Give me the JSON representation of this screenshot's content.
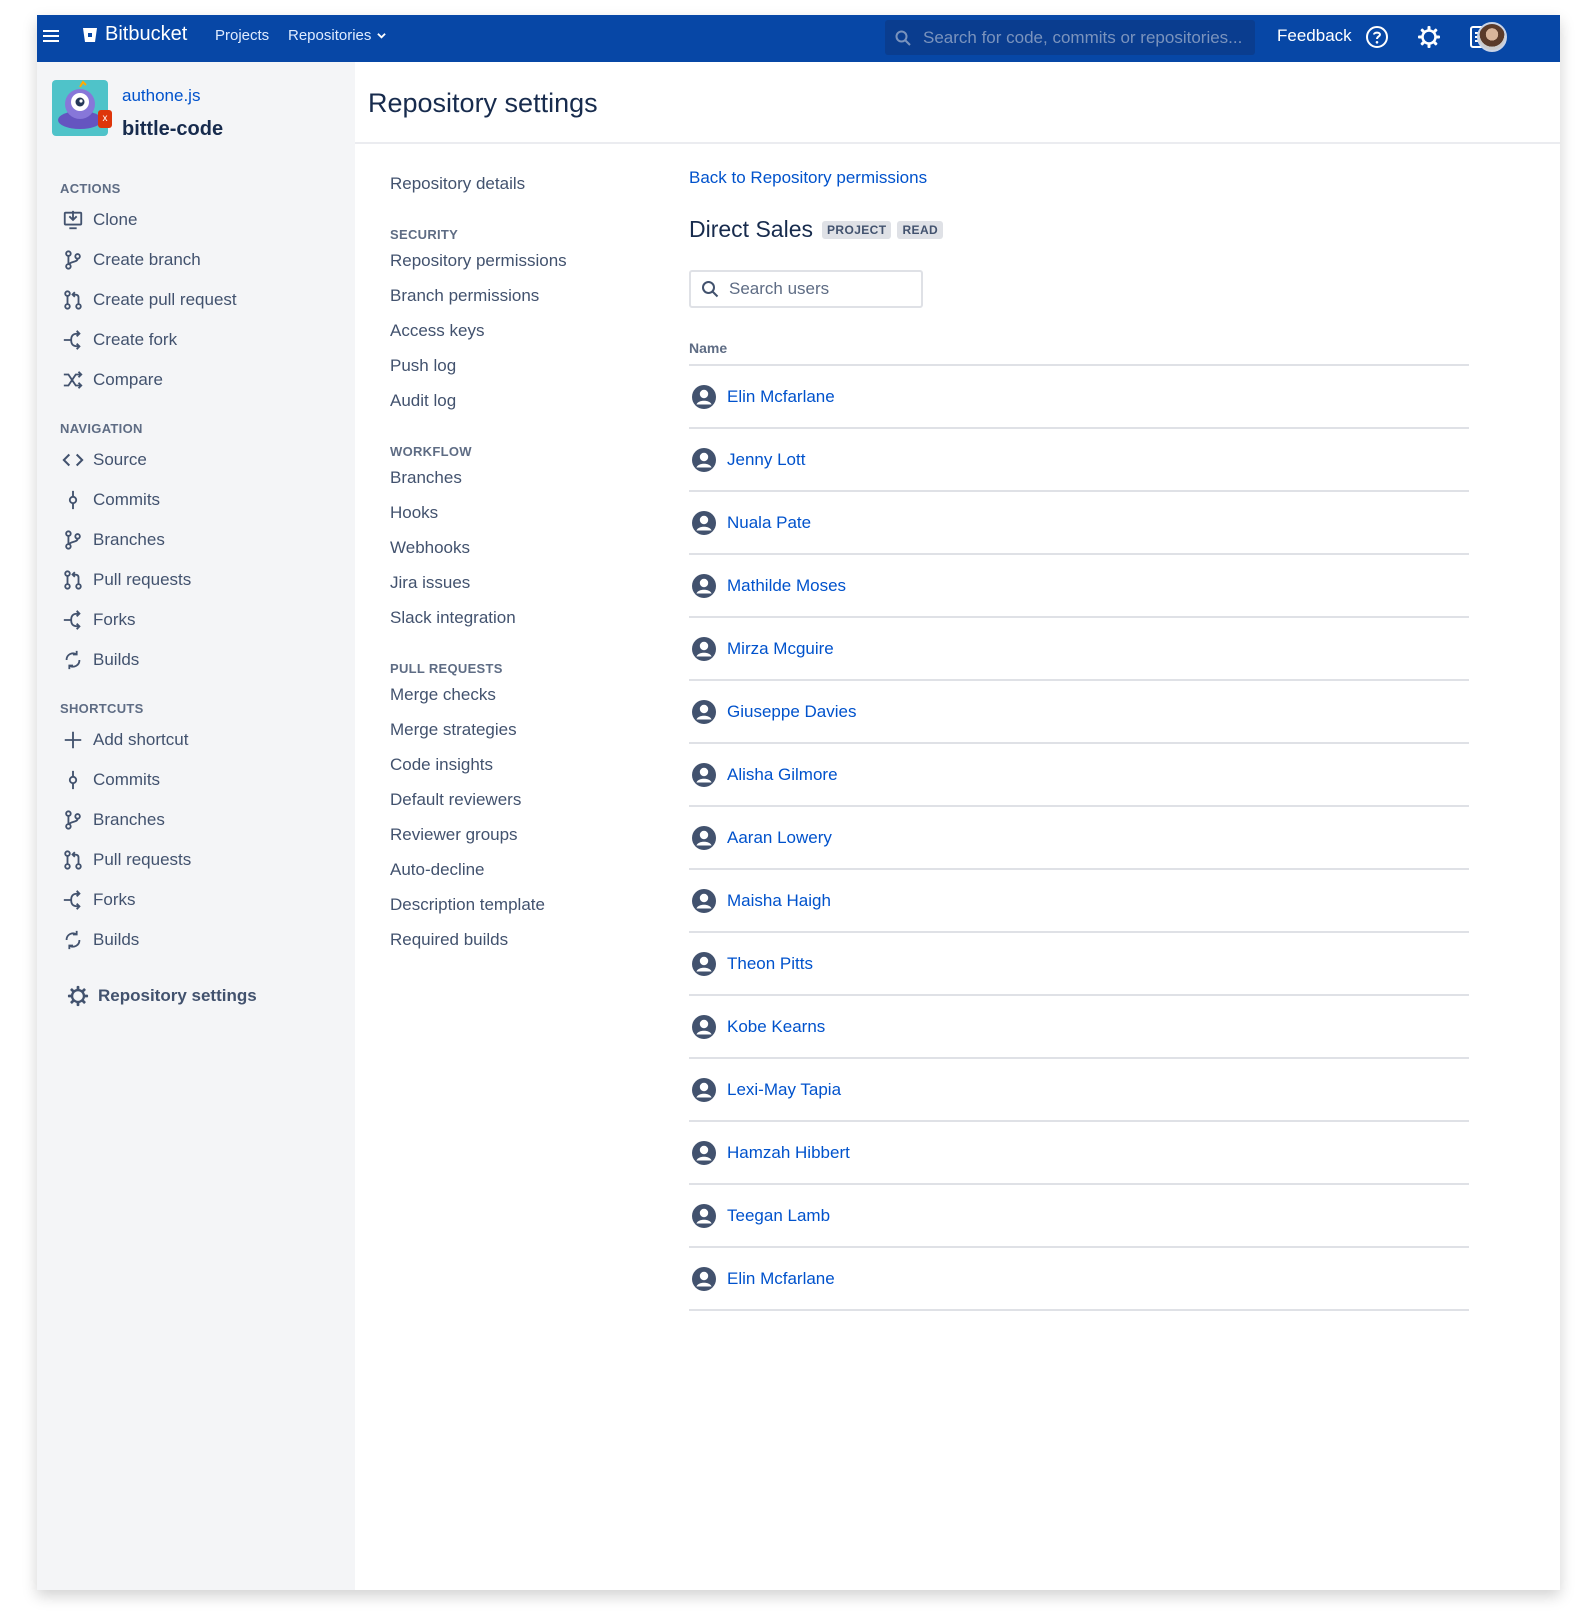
{
  "topbar": {
    "brand": "Bitbucket",
    "nav_projects": "Projects",
    "nav_repositories": "Repositories",
    "search_placeholder": "Search for code, commits or repositories...",
    "feedback": "Feedback"
  },
  "sidebar": {
    "project_name": "authone.js",
    "repo_name": "bittle-code",
    "repo_badge": "x",
    "sections": {
      "actions": "ACTIONS",
      "navigation": "NAVIGATION",
      "shortcuts": "SHORTCUTS"
    },
    "actions": [
      "Clone",
      "Create branch",
      "Create pull request",
      "Create fork",
      "Compare"
    ],
    "navigation": [
      "Source",
      "Commits",
      "Branches",
      "Pull requests",
      "Forks",
      "Builds"
    ],
    "shortcuts": [
      "Add shortcut",
      "Commits",
      "Branches",
      "Pull requests",
      "Forks",
      "Builds"
    ],
    "settings": "Repository settings"
  },
  "page": {
    "title": "Repository settings"
  },
  "subnav": {
    "repository_details": "Repository details",
    "security": {
      "heading": "SECURITY",
      "items": [
        "Repository permissions",
        "Branch permissions",
        "Access keys",
        "Push log",
        "Audit log"
      ]
    },
    "workflow": {
      "heading": "WORKFLOW",
      "items": [
        "Branches",
        "Hooks",
        "Webhooks",
        "Jira issues",
        "Slack integration"
      ]
    },
    "pull_requests": {
      "heading": "PULL REQUESTS",
      "items": [
        "Merge checks",
        "Merge strategies",
        "Code insights",
        "Default reviewers",
        "Reviewer groups",
        "Auto-decline",
        "Description template",
        "Required builds"
      ]
    }
  },
  "content": {
    "back_link": "Back to Repository permissions",
    "group_name": "Direct Sales",
    "lozenges": [
      "PROJECT",
      "READ"
    ],
    "search_placeholder": "Search users",
    "column_name": "Name",
    "users": [
      "Elin Mcfarlane",
      "Jenny Lott",
      "Nuala Pate",
      "Mathilde Moses",
      "Mirza Mcguire",
      "Giuseppe Davies",
      "Alisha Gilmore",
      "Aaran Lowery",
      "Maisha Haigh",
      "Theon Pitts",
      "Kobe Kearns",
      "Lexi-May Tapia",
      "Hamzah Hibbert",
      "Teegan Lamb",
      "Elin Mcfarlane"
    ]
  },
  "colors": {
    "topbar": "#0747a6",
    "link": "#0052cc",
    "sidebar_bg": "#f4f5f7",
    "text": "#172b4d",
    "muted": "#42526e"
  }
}
